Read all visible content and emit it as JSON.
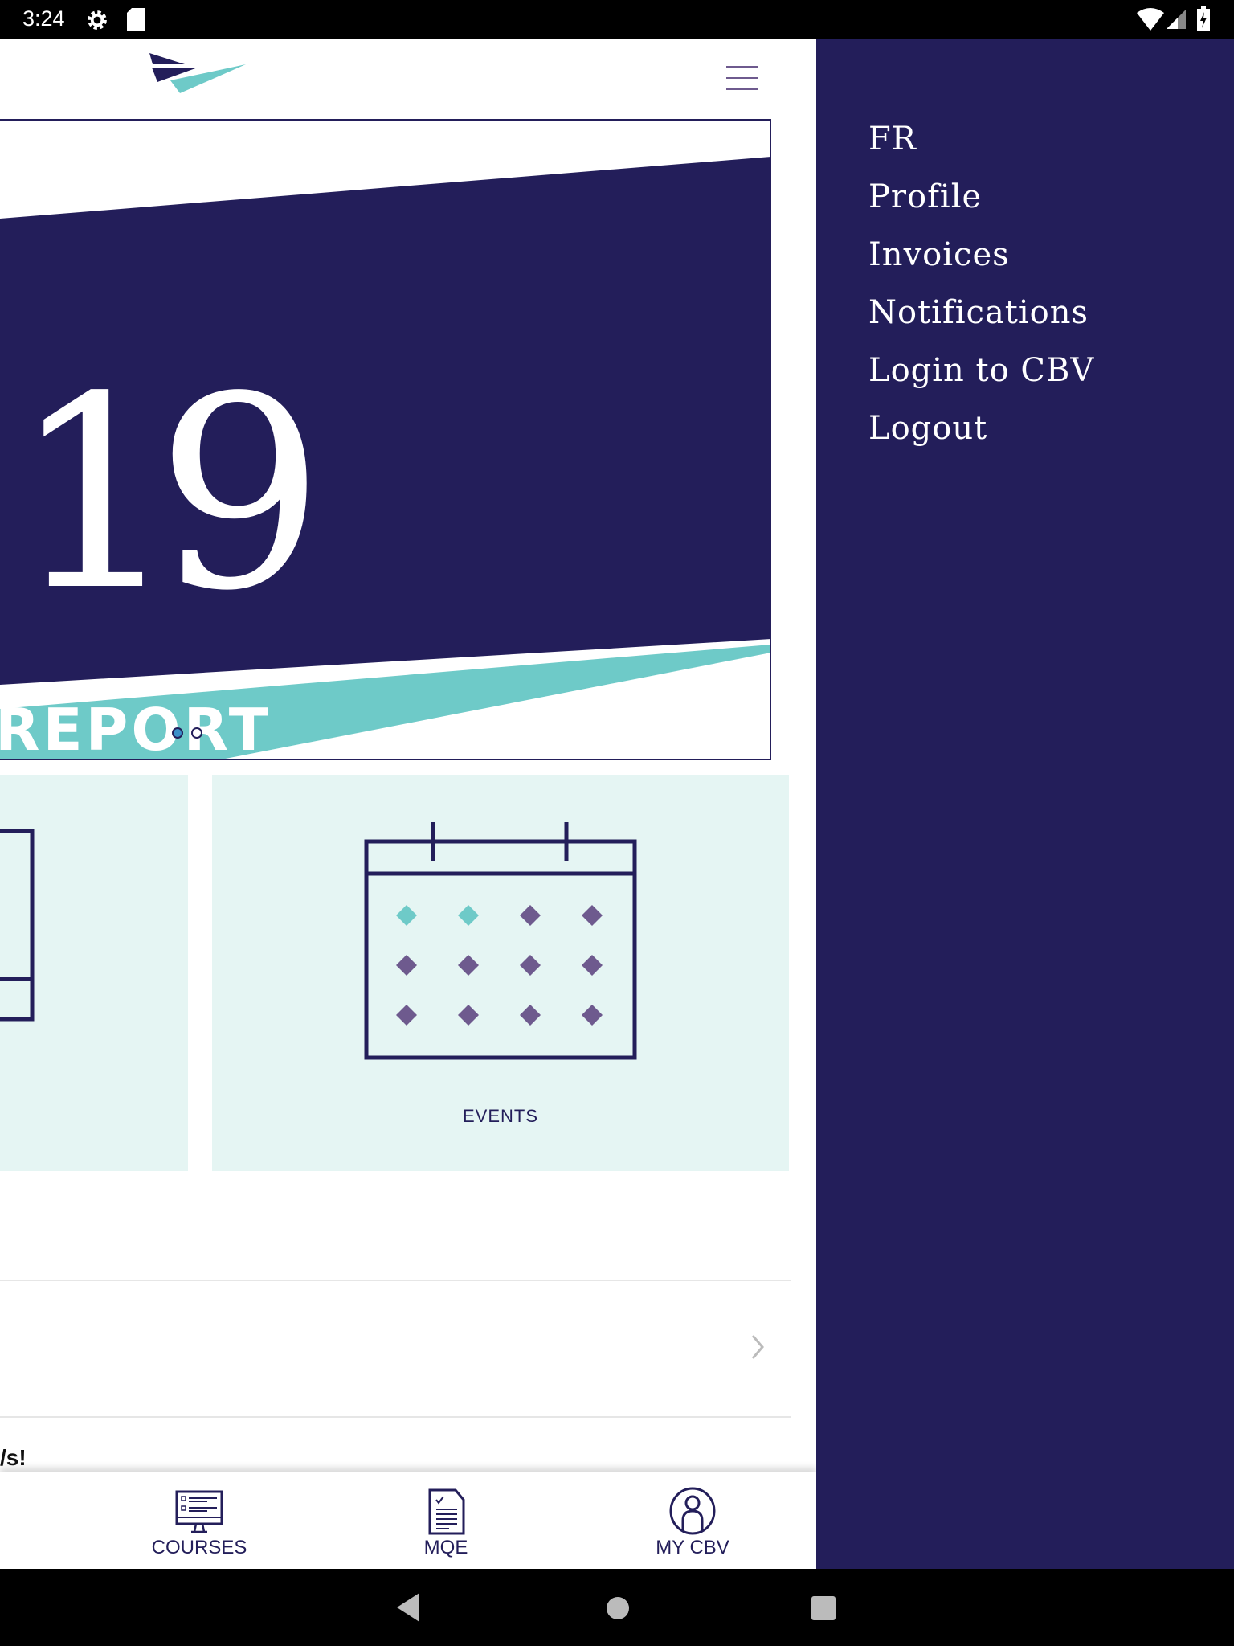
{
  "status_bar": {
    "time": "3:24",
    "icons": [
      "gear-icon",
      "sd-card-icon",
      "wifi-icon",
      "signal-icon",
      "battery-charging-icon"
    ]
  },
  "header": {
    "logo": "cbv-logo",
    "menu_icon": "hamburger-icon"
  },
  "banner": {
    "year_fragment": "19",
    "title_fragment": "REPORT",
    "slides": 2,
    "active_slide": 1
  },
  "tiles": [
    {
      "label": "EVENTS",
      "icon": "calendar-icon"
    }
  ],
  "partial_text": "/s!",
  "bottom_nav": [
    {
      "label": "COURSES",
      "icon": "monitor-list-icon"
    },
    {
      "label": "MQE",
      "icon": "document-check-icon"
    },
    {
      "label": "MY CBV",
      "icon": "user-circle-icon"
    }
  ],
  "drawer": {
    "items": [
      "FR",
      "Profile",
      "Invoices",
      "Notifications",
      "Login to CBV",
      "Logout"
    ]
  },
  "colors": {
    "navy": "#231e5a",
    "teal": "#6ecac8",
    "tile_bg": "#e5f5f3",
    "diamond": "#6e5a8e"
  }
}
